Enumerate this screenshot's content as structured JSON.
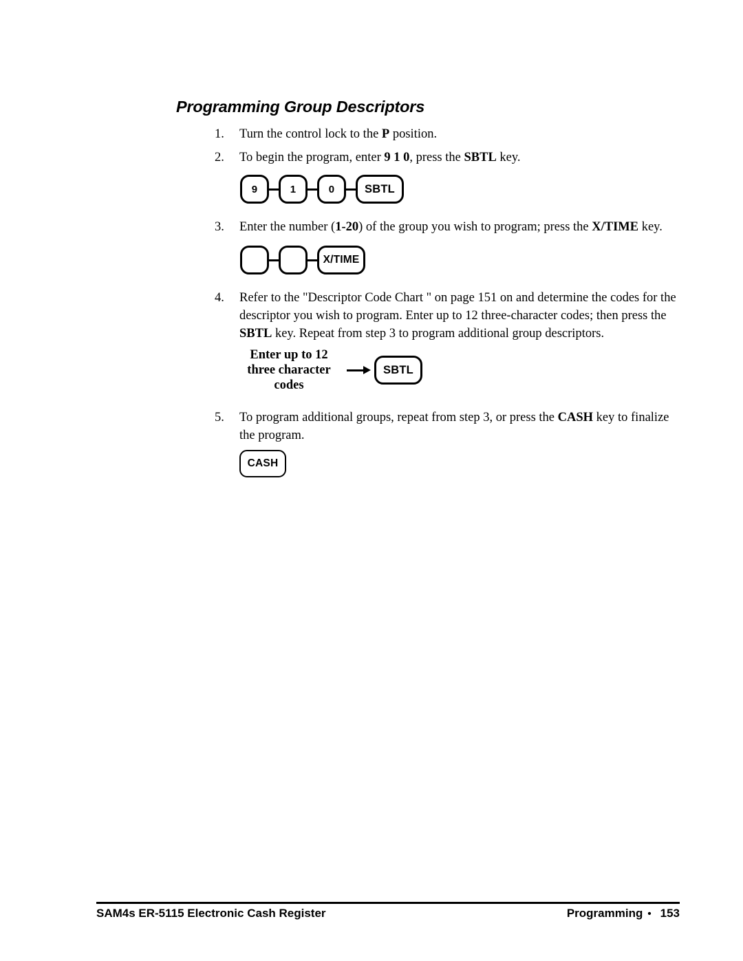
{
  "heading": "Programming Group Descriptors",
  "steps": [
    {
      "num": "1.",
      "parts": [
        {
          "t": "Turn the control lock to the ",
          "b": false
        },
        {
          "t": "P",
          "b": true
        },
        {
          "t": " position.",
          "b": false
        }
      ]
    },
    {
      "num": "2.",
      "parts": [
        {
          "t": "To begin the program, enter ",
          "b": false
        },
        {
          "t": "9 1 0",
          "b": true
        },
        {
          "t": ", press the ",
          "b": false
        },
        {
          "t": "SBTL",
          "b": true
        },
        {
          "t": " key.",
          "b": false
        }
      ]
    },
    {
      "num": "3.",
      "parts": [
        {
          "t": "Enter the number (",
          "b": false
        },
        {
          "t": "1-20",
          "b": true
        },
        {
          "t": ") of the group you wish to program; press the ",
          "b": false
        },
        {
          "t": "X/TIME",
          "b": true
        },
        {
          "t": " key.",
          "b": false
        }
      ]
    },
    {
      "num": "4.",
      "parts": [
        {
          "t": "Refer to the \"Descriptor Code Chart \" on page 151 on and determine the codes for the descriptor you wish to program.  Enter up to 12 three-character codes; then press the ",
          "b": false
        },
        {
          "t": "SBTL",
          "b": true
        },
        {
          "t": " key.  Repeat from step 3 to program additional group descriptors.",
          "b": false
        }
      ]
    },
    {
      "num": "5.",
      "parts": [
        {
          "t": "To program additional groups, repeat from step 3, or press the ",
          "b": false
        },
        {
          "t": "CASH",
          "b": true
        },
        {
          "t": " key to finalize the program.",
          "b": false
        }
      ]
    }
  ],
  "key_diagrams": {
    "step2_sequence": [
      {
        "label": "9",
        "type": "num"
      },
      {
        "label": "1",
        "type": "num"
      },
      {
        "label": "0",
        "type": "num"
      },
      {
        "label": "SBTL",
        "type": "wide"
      }
    ],
    "step3_sequence": [
      {
        "label": "",
        "type": "num"
      },
      {
        "label": "",
        "type": "num"
      },
      {
        "label": "X/TIME",
        "type": "xtime"
      }
    ],
    "step4_label_lines": [
      "Enter up to 12",
      "three character",
      "codes"
    ],
    "step4_key": "SBTL",
    "step5_key": "CASH"
  },
  "footer": {
    "left": "SAM4s ER-5115 Electronic Cash Register",
    "right_section": "Programming",
    "right_bullet": "•",
    "right_page": "153"
  }
}
